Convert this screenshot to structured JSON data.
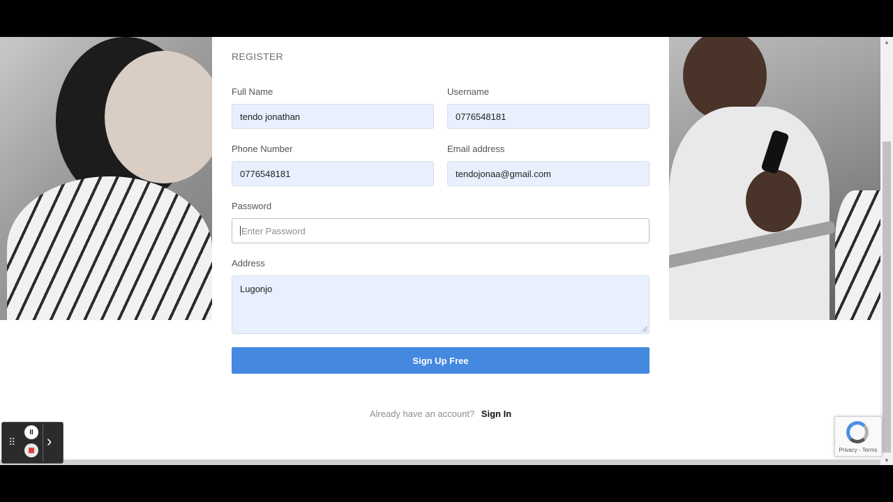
{
  "form": {
    "title": "REGISTER",
    "full_name": {
      "label": "Full Name",
      "value": "tendo jonathan"
    },
    "username": {
      "label": "Username",
      "value": "0776548181"
    },
    "phone": {
      "label": "Phone Number",
      "value": "0776548181"
    },
    "email": {
      "label": "Email address",
      "value": "tendojonaa@gmail.com"
    },
    "password": {
      "label": "Password",
      "placeholder": "Enter Password"
    },
    "address": {
      "label": "Address",
      "value": "Lugonjo"
    },
    "submit_label": "Sign Up Free",
    "signin_prompt": "Already have an account?",
    "signin_link": "Sign In"
  },
  "recaptcha": {
    "footer": "Privacy - Terms"
  },
  "recorder": {
    "pause_glyph": "II",
    "next_glyph": "›",
    "grip_glyph": "⠿"
  },
  "colors": {
    "button": "#4488e0",
    "filled_input": "#e8f0fe"
  }
}
